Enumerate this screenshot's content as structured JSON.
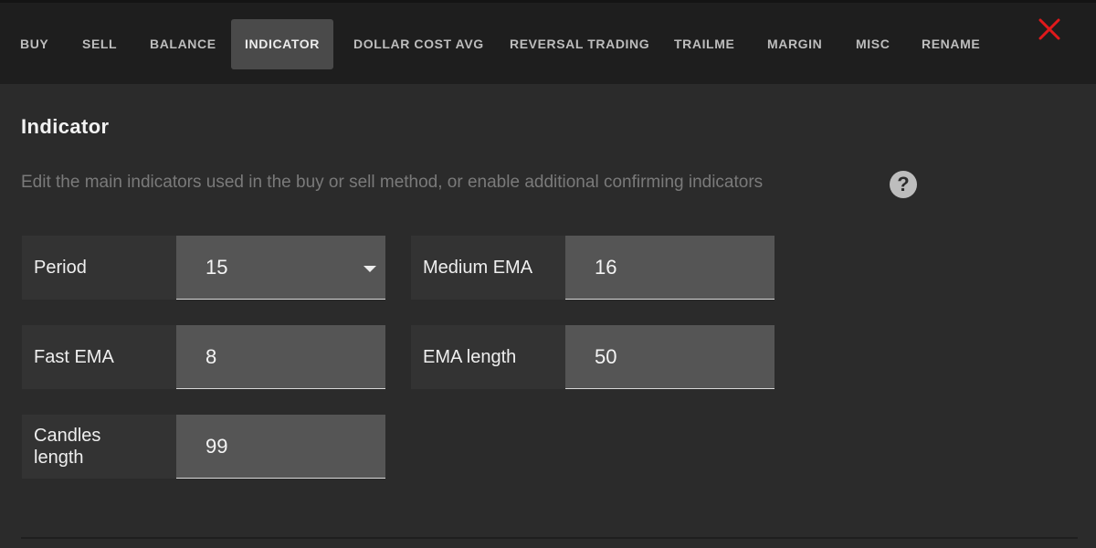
{
  "tabs": [
    {
      "label": "BUY"
    },
    {
      "label": "SELL"
    },
    {
      "label": "BALANCE"
    },
    {
      "label": "INDICATOR",
      "active": true
    },
    {
      "label": "DOLLAR COST AVG"
    },
    {
      "label": "REVERSAL TRADING"
    },
    {
      "label": "TRAILME"
    },
    {
      "label": "MARGIN"
    },
    {
      "label": "MISC"
    },
    {
      "label": "RENAME"
    }
  ],
  "close_icon": "close-x-icon",
  "help_icon": "question-mark-icon",
  "colors": {
    "close": "#e0191b",
    "active_tab_bg": "#4a4a4a",
    "panel_bg": "#2b2b2b",
    "tabbar_bg": "#1e1e1e"
  },
  "content": {
    "title": "Indicator",
    "description": "Edit the main indicators used in the buy or sell method, or enable additional confirming indicators",
    "help": "?"
  },
  "fields": {
    "period": {
      "label": "Period",
      "value": "15"
    },
    "medium_ema": {
      "label": "Medium EMA",
      "value": "16"
    },
    "fast_ema": {
      "label": "Fast EMA",
      "value": "8"
    },
    "ema_length": {
      "label": "EMA length",
      "value": "50"
    },
    "candles_length": {
      "label": "Candles length",
      "value": "99"
    }
  }
}
